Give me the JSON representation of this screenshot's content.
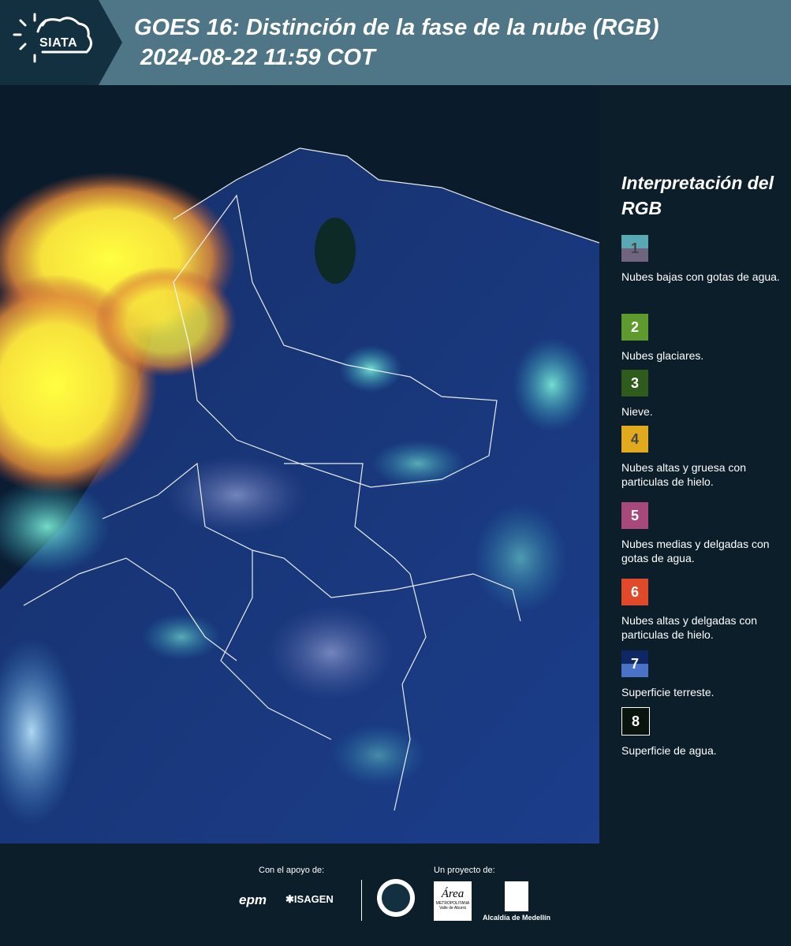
{
  "header": {
    "logo_text": "SIATA",
    "title_line1": "GOES 16: Distinción de la fase de la nube (RGB)",
    "title_line2": " 2024-08-22 11:59 COT"
  },
  "legend": {
    "title": "Interpretación del RGB",
    "items": [
      {
        "number": "1",
        "label": "Nubes bajas con gotas de agua.",
        "color_top": "#5aa8b4",
        "color_bottom": "#6f6580"
      },
      {
        "number": "2",
        "label": "Nubes glaciares.",
        "color_top": "#5e9a2e",
        "color_bottom": "#5e9a2e"
      },
      {
        "number": "3",
        "label": "Nieve.",
        "color_top": "#2f5c1c",
        "color_bottom": "#2f5c1c"
      },
      {
        "number": "4",
        "label": "Nubes altas y gruesa con particulas de hielo.",
        "color_top": "#e0a91e",
        "color_bottom": "#e0a91e"
      },
      {
        "number": "5",
        "label": "Nubes medias y delgadas con gotas de agua.",
        "color_top": "#a8497c",
        "color_bottom": "#a8497c"
      },
      {
        "number": "6",
        "label": "Nubes altas y delgadas con particulas de hielo.",
        "color_top": "#e04a2a",
        "color_bottom": "#e04a2a"
      },
      {
        "number": "7",
        "label": "Superficie terreste.",
        "color_top": "#0f2864",
        "color_bottom": "#4a73c8"
      },
      {
        "number": "8",
        "label": "Superficie de agua.",
        "color_top": "#0a140f",
        "color_bottom": "#0a140f"
      }
    ]
  },
  "footer": {
    "support_label": "Con el apoyo de:",
    "project_label": "Un proyecto de:",
    "sponsor_1": "epm",
    "sponsor_2": "ISAGEN",
    "partner_area": "Área",
    "partner_area_sub": "METROPOLITANA Valle de Aburrá",
    "partner_alcaldia": "Alcaldía de Medellín"
  }
}
